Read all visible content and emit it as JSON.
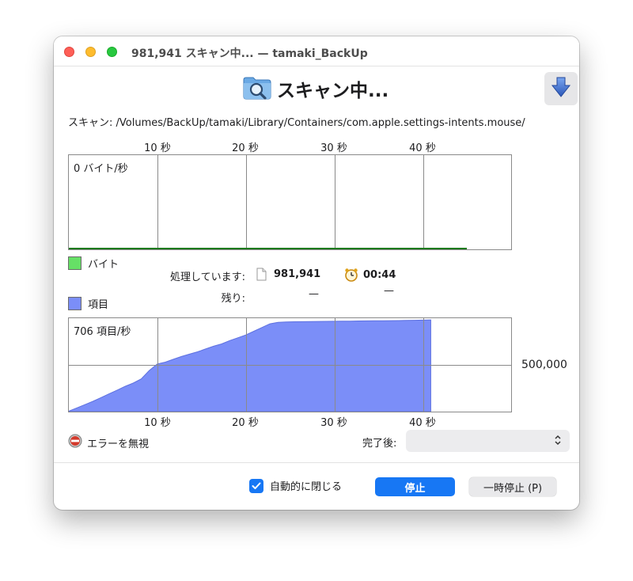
{
  "window": {
    "title": "981,941 スキャン中... — tamaki_BackUp"
  },
  "header": {
    "title": "スキャン中...",
    "icon": "folder-magnifier-icon",
    "toolbar_icon": "download-arrow-icon"
  },
  "scan": {
    "path_text": "スキャン: /Volumes/BackUp/tamaki/Library/Containers/com.apple.settings-intents.mouse/"
  },
  "bytes_graph": {
    "rate": "0 バイト/秒",
    "legend": "バイト",
    "legend_color": "#66e066",
    "line_color": "#1d7a1d",
    "ticks": [
      "10 秒",
      "20 秒",
      "30 秒",
      "40 秒"
    ]
  },
  "stats": {
    "processing_label": "処理しています:",
    "processed_count": "981,941",
    "elapsed_time": "00:44",
    "remaining_label": "残り:",
    "remaining_count": "—",
    "remaining_time": "—"
  },
  "items_graph": {
    "rate": "706 項目/秒",
    "legend": "項目",
    "fill_color": "#7b8ef8",
    "scale_label": "500,000",
    "ticks": [
      "10 秒",
      "20 秒",
      "30 秒",
      "40 秒"
    ],
    "chart_data": {
      "type": "area",
      "x": [
        0,
        1,
        2,
        3,
        4,
        5,
        6,
        7,
        8,
        9,
        10,
        11,
        12,
        13,
        14,
        15,
        16,
        17,
        18,
        19,
        20,
        21,
        22,
        23,
        24,
        25,
        26,
        27,
        28,
        29,
        30,
        31,
        32,
        33,
        34,
        35,
        36,
        37,
        38,
        39,
        40,
        41,
        42,
        43,
        44,
        45
      ],
      "values": [
        5000,
        40000,
        75000,
        110000,
        150000,
        190000,
        230000,
        270000,
        305000,
        350000,
        440000,
        510000,
        530000,
        560000,
        590000,
        615000,
        640000,
        670000,
        700000,
        725000,
        760000,
        790000,
        820000,
        860000,
        900000,
        940000,
        955000,
        960000,
        962000,
        963000,
        964000,
        965000,
        966000,
        967000,
        968000,
        969000,
        970000,
        971000,
        972000,
        973000,
        974000,
        975000,
        976000,
        978000,
        980000,
        981941
      ],
      "ylim": [
        0,
        1000000
      ],
      "xlim": [
        0,
        55
      ],
      "gridline": 500000,
      "tick_labels": [
        "10 秒",
        "20 秒",
        "30 秒",
        "40 秒"
      ]
    }
  },
  "footer": {
    "ignore_errors_label": "エラーを無視",
    "after_label": "完了後:",
    "after_value": "",
    "auto_close_label": "自動的に閉じる",
    "auto_close_checked": true,
    "stop_label": "停止",
    "pause_label": "一時停止 (P)",
    "accent_color": "#1777f4"
  }
}
